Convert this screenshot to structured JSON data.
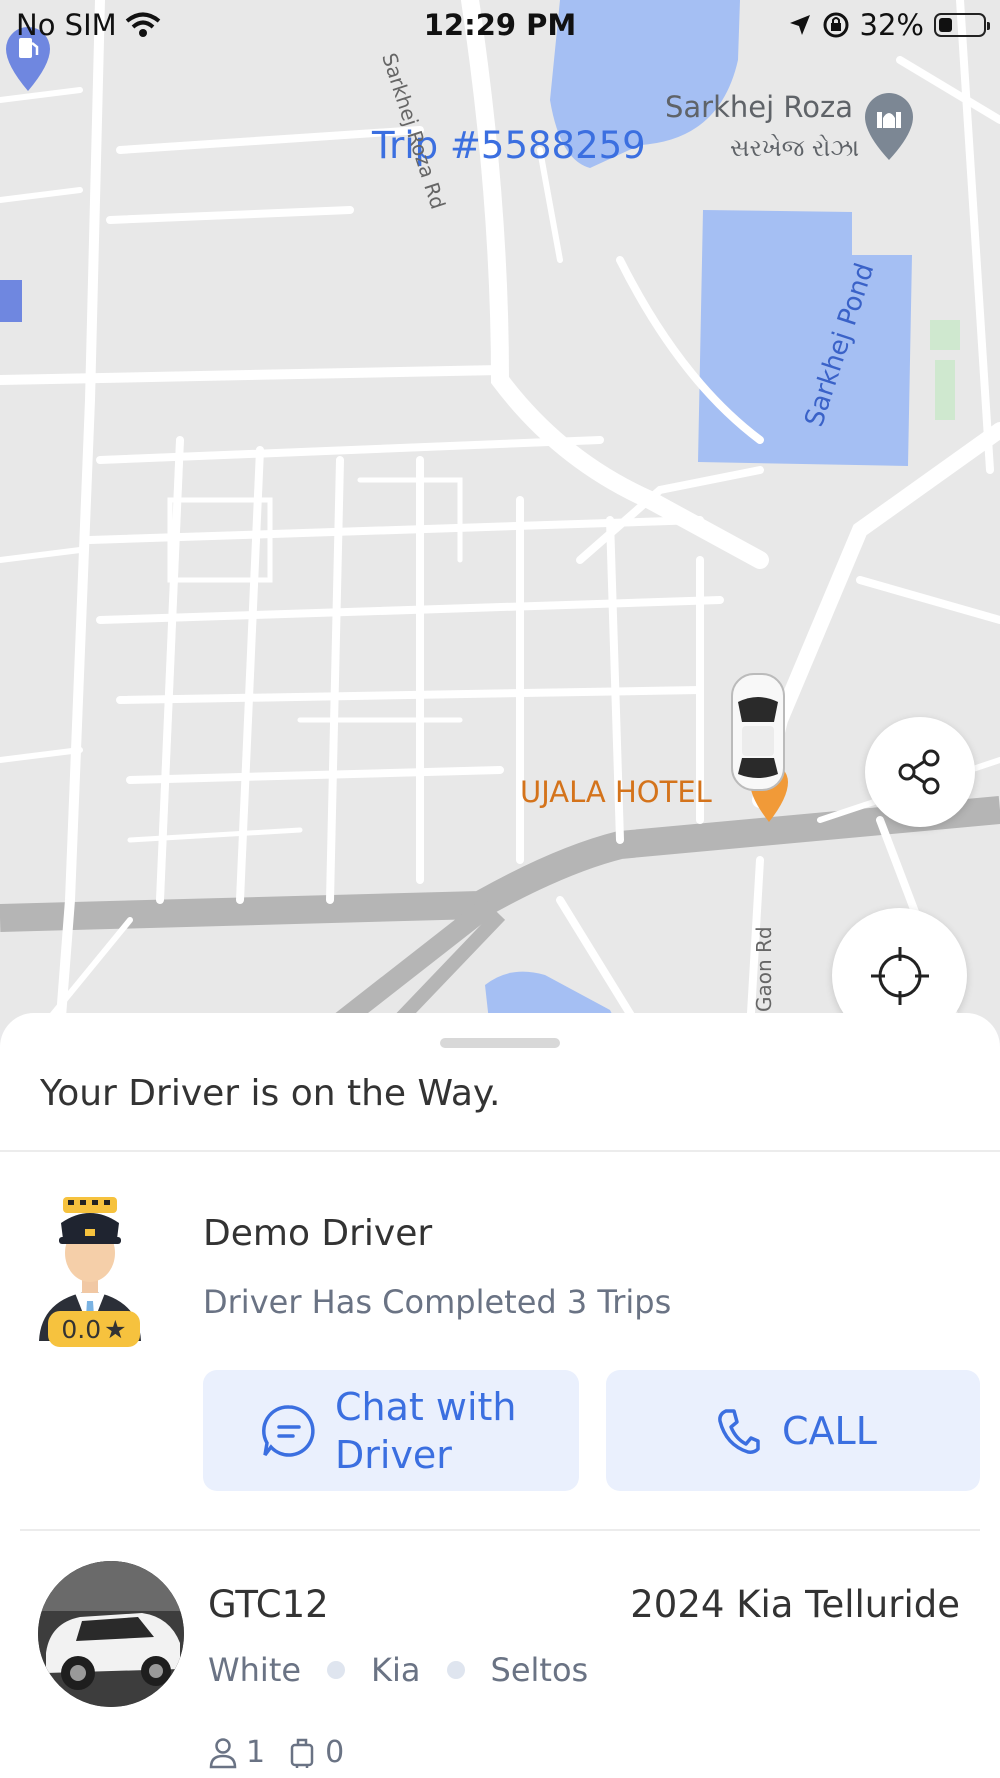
{
  "status_bar": {
    "carrier": "No SIM",
    "time": "12:29 PM",
    "battery": "32%",
    "battery_level": 0.32
  },
  "map": {
    "trip_label": "Trip #5588259",
    "poi_name": "Sarkhej Roza",
    "poi_name_local": "સરખેજ રોઝા",
    "pond_label": "Sarkhej Pond",
    "hotel_label": "UJALA HOTEL",
    "road_label_1": "Sarkhej Roza Rd",
    "road_label_2": "Gaon Rd",
    "colors": {
      "water": "#a5bff3",
      "roads": "#ffffff",
      "land": "#e8e8e8",
      "highway": "#b5b5b5"
    }
  },
  "sheet": {
    "status_text": "Your Driver is on the Way.",
    "driver": {
      "name": "Demo Driver",
      "trips_text": "Driver Has Completed 3 Trips",
      "rating": "0.0",
      "rating_icon": "star-icon"
    },
    "chat_button": {
      "label_line1": "Chat with",
      "label_line2": "Driver",
      "icon": "chat-bubble-icon"
    },
    "call_button": {
      "label": "CALL",
      "icon": "phone-icon"
    },
    "vehicle": {
      "plate": "GTC12",
      "model": "2024 Kia Telluride",
      "color": "White",
      "make": "Kia",
      "variant": "Seltos",
      "passengers": "1",
      "luggage": "0"
    }
  },
  "accent_color": "#3b6fe0"
}
